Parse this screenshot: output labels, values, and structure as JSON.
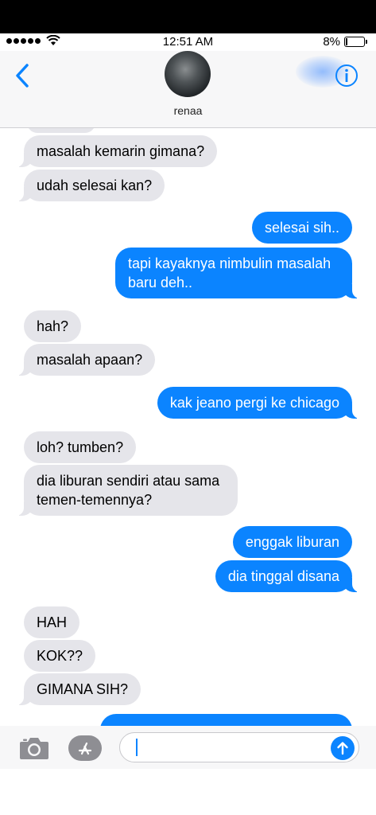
{
  "status_bar": {
    "time": "12:51 AM",
    "battery_percent": "8%",
    "battery_level": 0.08,
    "signal_icon": "cellular-signal-icon",
    "wifi_icon": "wifi-icon"
  },
  "header": {
    "contact_name": "renaa",
    "back_icon": "chevron-left-icon",
    "info_icon": "info-icon"
  },
  "messages": [
    {
      "from": "them",
      "text": "masalah kemarin gimana?"
    },
    {
      "from": "them",
      "text": "udah selesai kan?"
    },
    {
      "from": "me",
      "text": "selesai sih.."
    },
    {
      "from": "me",
      "text": "tapi kayaknya nimbulin masalah",
      "text2": "baru deh.."
    },
    {
      "from": "them",
      "text": "hah?"
    },
    {
      "from": "them",
      "text": "masalah apaan?"
    },
    {
      "from": "me",
      "text": "kak jeano pergi ke chicago"
    },
    {
      "from": "them",
      "text": "loh? tumben?"
    },
    {
      "from": "them",
      "text": "dia liburan sendiri atau sama",
      "text2": "temen-temennya?"
    },
    {
      "from": "me",
      "text": "enggak liburan"
    },
    {
      "from": "me",
      "text": "dia tinggal disana"
    },
    {
      "from": "them",
      "text": "HAH"
    },
    {
      "from": "them",
      "text": "KOK??"
    },
    {
      "from": "them",
      "text": "GIMANA SIH?"
    }
  ],
  "composer": {
    "camera_icon": "camera-icon",
    "apps_icon": "app-store-icon",
    "send_icon": "send-arrow-icon",
    "value": ""
  },
  "colors": {
    "sent_bubble": "#0b84ff",
    "received_bubble": "#e5e5ea",
    "accent": "#0b84ff"
  }
}
